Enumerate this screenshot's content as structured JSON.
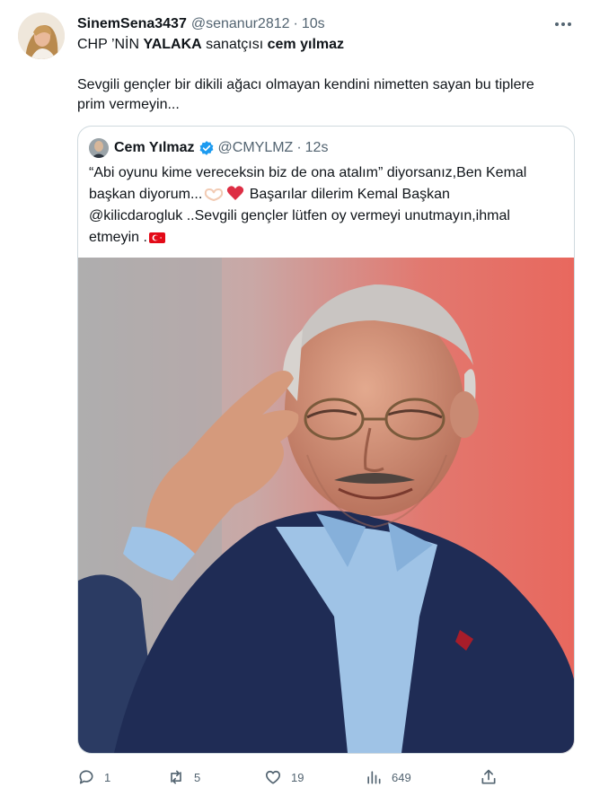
{
  "tweet": {
    "display_name": "SinemSena3437",
    "handle": "@senanur2812",
    "separator": "·",
    "time": "10s",
    "text_line1": {
      "a": "CHP ’NİN ",
      "b": "YALAKA",
      "c": " sanatçısı ",
      "d": "cem yılmaz"
    },
    "text_line2a": "Sevgili gençler bir dikili ağacı olmayan kendini nimetten sayan bu tiplere",
    "text_line2b": "prim vermeyin..."
  },
  "quoted": {
    "display_name": "Cem Yılmaz",
    "handle": "@CMYLMZ",
    "separator": "·",
    "time": "12s",
    "line1": "“Abi oyunu kime vereceksin biz de ona atalım” diyorsanız,Ben Kemal",
    "line2a": "başkan diyorum...",
    "line2b": " Başarılar dilerim Kemal Başkan",
    "line3": "@kilicdarogluk ..Sevgili gençler lütfen oy vermeyi unutmayın,ihmal",
    "line4": "etmeyin ."
  },
  "actions": {
    "replies": "1",
    "retweets": "5",
    "likes": "19",
    "views": "649"
  },
  "icons": {
    "more": "more-icon",
    "verified": "verified-badge-icon",
    "reply": "reply-icon",
    "retweet": "retweet-icon",
    "like": "like-icon",
    "views": "views-icon",
    "share": "share-icon"
  },
  "colors": {
    "text": "#0f1419",
    "secondary": "#536471",
    "border": "#cfd9de",
    "verified": "#1d9bf0"
  }
}
